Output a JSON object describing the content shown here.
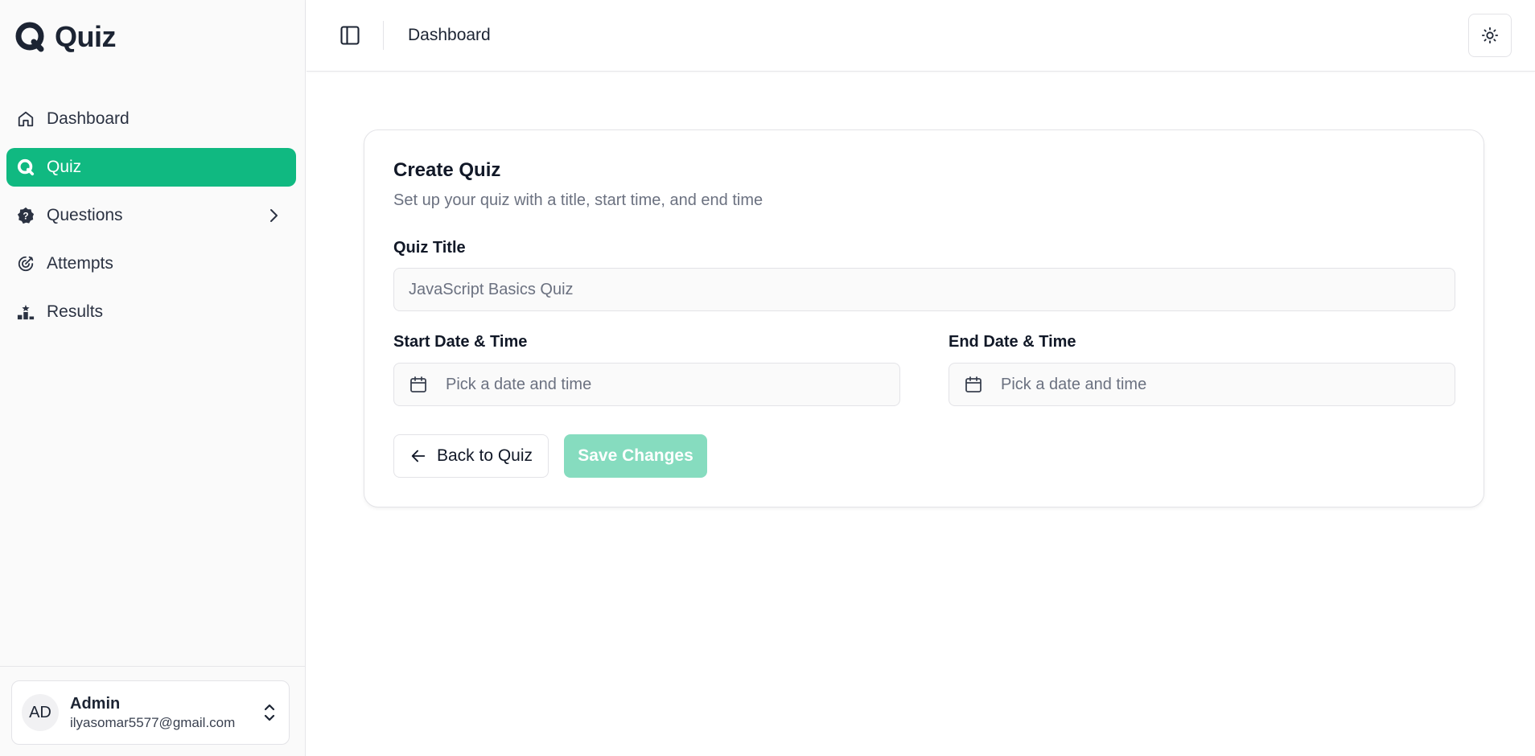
{
  "app": {
    "name": "Quiz"
  },
  "sidebar": {
    "items": [
      {
        "label": "Dashboard",
        "icon": "home-icon"
      },
      {
        "label": "Quiz",
        "icon": "quiz-icon",
        "active": true
      },
      {
        "label": "Questions",
        "icon": "question-badge-icon",
        "has_submenu": true
      },
      {
        "label": "Attempts",
        "icon": "target-icon"
      },
      {
        "label": "Results",
        "icon": "podium-icon"
      }
    ],
    "user": {
      "initials": "AD",
      "name": "Admin",
      "email": "ilyasomar5577@gmail.com"
    }
  },
  "header": {
    "title": "Dashboard"
  },
  "form": {
    "title": "Create Quiz",
    "subtitle": "Set up your quiz with a title, start time, and end time",
    "quiz_title_label": "Quiz Title",
    "quiz_title_placeholder": "JavaScript Basics Quiz",
    "start_label": "Start Date & Time",
    "start_placeholder": "Pick a date and time",
    "end_label": "End Date & Time",
    "end_placeholder": "Pick a date and time",
    "back_label": "Back to Quiz",
    "save_label": "Save Changes"
  },
  "colors": {
    "accent": "#10b981",
    "accent_disabled": "#86dcbf",
    "sidebar_bg": "#fafafa",
    "text_primary": "#1c2433",
    "text_muted": "#6b7180"
  }
}
